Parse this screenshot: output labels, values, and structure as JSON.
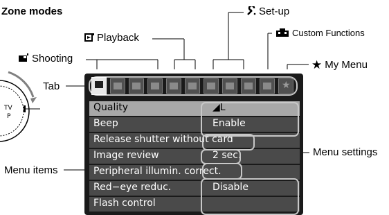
{
  "heading": "Zone modes",
  "labels": {
    "setup": "Set-up",
    "playback": "Playback",
    "custom_functions": "Custom Functions",
    "shooting": "Shooting",
    "my_menu": "My Menu",
    "tab": "Tab",
    "menu_settings": "Menu settings",
    "menu_items": "Menu items"
  },
  "icons": {
    "setup": "wrench-icon",
    "playback": "playback-icon",
    "custom_functions": "custom-functions-icon",
    "shooting": "camera-icon",
    "my_menu": "star-icon"
  },
  "tabs": [
    {
      "icon": "camera-icon",
      "active": true
    },
    {
      "icon": "camera-icon",
      "active": false
    },
    {
      "icon": "camera-icon",
      "active": false
    },
    {
      "icon": "camera-icon",
      "active": false
    },
    {
      "icon": "playback-icon",
      "active": false
    },
    {
      "icon": "playback-icon",
      "active": false
    },
    {
      "icon": "wrench-icon",
      "active": false
    },
    {
      "icon": "wrench-icon",
      "active": false
    },
    {
      "icon": "wrench-icon",
      "active": false
    },
    {
      "icon": "custom-functions-icon",
      "active": false
    },
    {
      "icon": "star-icon",
      "active": false
    }
  ],
  "menu": [
    {
      "item": "Quality",
      "value": "◢L",
      "selected": true
    },
    {
      "item": "Beep",
      "value": "Enable",
      "selected": false
    },
    {
      "item": "Release shutter without card",
      "value": "",
      "selected": false
    },
    {
      "item": "Image review",
      "value": "2 sec.",
      "selected": false
    },
    {
      "item": "Peripheral illumin. correct.",
      "value": "",
      "selected": false
    },
    {
      "item": "Red−eye reduc.",
      "value": "Disable",
      "selected": false
    },
    {
      "item": "Flash control",
      "value": "",
      "selected": false
    }
  ],
  "dial_letters": [
    "TV",
    "P"
  ],
  "colors": {
    "screen": "#1a1a1a",
    "row": "#4a4a4a",
    "row_selected": "#a8a8a8",
    "frame": "#c8c8c8"
  }
}
